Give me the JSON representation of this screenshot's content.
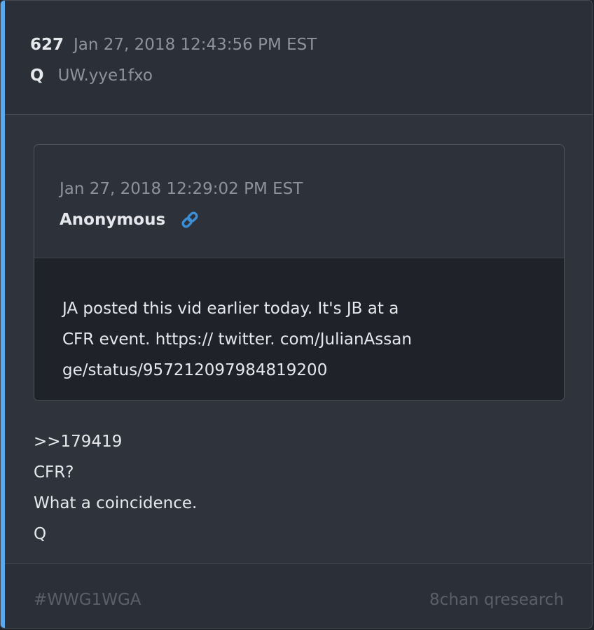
{
  "post": {
    "number": "627",
    "timestamp": "Jan 27, 2018 12:43:56 PM EST",
    "author": "Q",
    "tripcode": "UW.yye1fxo"
  },
  "quoted_post": {
    "timestamp": "Jan 27, 2018 12:29:02 PM EST",
    "author": "Anonymous",
    "link_icon": "link-icon",
    "text": "JA posted this vid earlier today. It's JB at a CFR event. https:// twitter. com/JulianAssange/status/957212097984819200"
  },
  "reply": {
    "lines": [
      ">>179419",
      "CFR?",
      "What a coincidence.",
      "Q"
    ]
  },
  "footer": {
    "hashtag": "#WWG1WGA",
    "source": "8chan qresearch"
  },
  "colors": {
    "accent": "#5aa9f0",
    "link": "#3b8fd6"
  }
}
